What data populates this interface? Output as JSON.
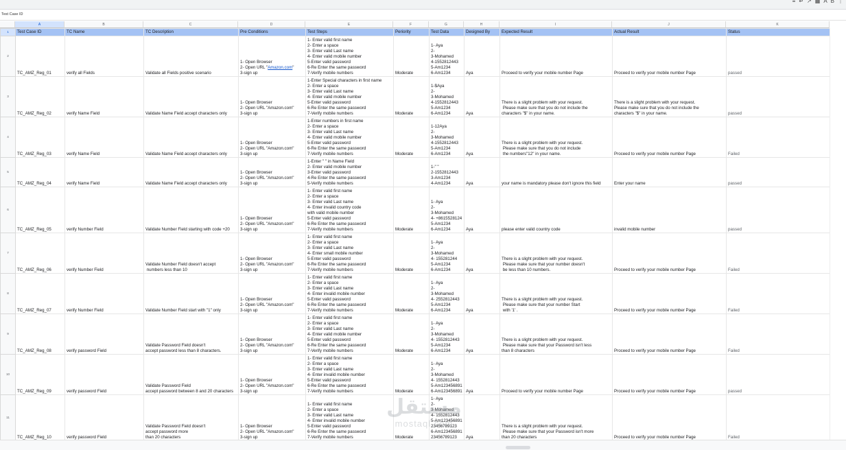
{
  "formula_bar": {
    "cell_value": "Test Case ID"
  },
  "columns": [
    "A",
    "B",
    "C",
    "D",
    "E",
    "F",
    "G",
    "H",
    "I",
    "J",
    "K"
  ],
  "selected_column": "A",
  "header_row": {
    "row_number": "1",
    "cells": [
      "Test Case ID",
      "TC Name",
      "TC Description",
      "Pre Conditions",
      "Test Steps",
      "Periority",
      "Test Data",
      "Designed By",
      "Expected Result",
      "Actual Result",
      "Status"
    ]
  },
  "rows": [
    {
      "row_number": "2",
      "cells": [
        "TC_AMZ_Reg_01",
        "verify all Fields",
        "Validate all Fields positive scenario",
        "1- Open Browser\n2- Open URL \"Amazon.com\"\n3-sign up",
        "1- Enter valid first name\n2- Enter a space\n3- Enter valid Last name\n4- Enter valid mobile number\n5-Enter valid password\n6-Re Enter the same password\n7-Verify mobile numbers",
        "Moderate",
        "1- Aya\n2-\n3-Mohamed\n4-1552812443\n5-Am1234\n6-Am1234",
        "Aya",
        "Proceed to verify your mobile number Page",
        "Proceed to verify your mobile number Page",
        "passed"
      ]
    },
    {
      "row_number": "3",
      "cells": [
        "TC_AMZ_Reg_02",
        "verify Name Field",
        "Validate Name Field accept characters only",
        "1- Open Browser\n2- Open URL \"Amazon.com\"\n3-sign up",
        "1-Enter Special characters in first name\n2- Enter a space\n3- Enter valid Last name\n4- Enter valid mobile number\n5-Enter valid password\n6-Re Enter the same password\n7-Verify mobile numbers",
        "Moderate",
        "1-$Aya\n2-\n3-Mohamed\n4-1552812443\n5-Am1234\n6-Am1234",
        "Aya",
        "There is a slight problem with your request.\n Please make sure that you do not include the\ncharacters \"$\" in your name.",
        "There is a slight problem with your request.\nPlease make sure that you do not include the\ncharacters \"$\" in your name.",
        "passed"
      ]
    },
    {
      "row_number": "4",
      "cells": [
        "TC_AMZ_Reg_03",
        "verify Name Field",
        "Validate Name Field accept characters only",
        "1- Open Browser\n2- Open URL \"Amazon.com\"\n3-sign up",
        "1-Enter numbers in first name\n2- Enter a space\n3- Enter valid Last name\n4- Enter valid mobile number\n5-Enter valid password\n6-Re Enter the same password\n7-Verify mobile numbers",
        "Moderate",
        "1-12Aya\n2-\n3-Mohamed\n4-1552812443\n5-Am1234\n6-Am1234",
        "Aya",
        "There is a slight problem with your request.\n Please make sure that you do not include\n the numbers\"12\" in your name.",
        "Proceed to verify your mobile number Page",
        "Failed"
      ]
    },
    {
      "row_number": "5",
      "cells": [
        "TC_AMZ_Reg_04",
        "verify Name Field",
        "Validate Name Field accept characters only",
        "1- Open Browser\n2- Open URL \"Amazon.com\"\n3-sign up",
        "1-Enter \" \" in Name Field\n2- Enter valid mobile number\n3-Enter valid password\n4-Re Enter the same password\n5-Verify mobile numbers",
        "",
        "1-\" \"\n2-1552812443\n3-Am1234\n4-Am1234",
        "Aya",
        "your name is mandatory please don't ignore this field",
        "Enter your name",
        "passed"
      ]
    },
    {
      "row_number": "6",
      "cells": [
        "TC_AMZ_Reg_05",
        "verify Number Field",
        "Validate Number Field starting with code +20",
        "1- Open Browser\n2- Open URL \"Amazon.com\"\n3-sign up",
        "1- Enter valid first name\n2- Enter a space\n3- Enter valid Last name\n4- Enter invalid country code\nwith valid mobile number\n5-Enter valid password\n6-Re Enter the same password\n7-Verify mobile numbers",
        "Moderate",
        "1- Aya\n2-\n3-Mohamed\n4- +8615528124\n5-Am1234\n6-Am1234",
        "Aya",
        "please enter valid country code",
        "invalid mobile number",
        "passed"
      ]
    },
    {
      "row_number": "7",
      "cells": [
        "TC_AMZ_Reg_06",
        "verify Number Field",
        "Validate Number Field doesn't accept\n numbers less than 10",
        "1- Open Browser\n2- Open URL \"Amazon.com\"\n3-sign up",
        "1- Enter valid first name\n2- Enter a space\n3- Enter valid Last name\n4- Enter small mobile number\n5-Enter valid password\n6-Re Enter the same password\n7-Verify mobile numbers",
        "Moderate",
        "1- Aya\n2-\n3-Mohamed\n4- 155281244\n5-Am1234\n6-Am1234",
        "Aya",
        "There is a slight problem with your request.\n Please make sure that your number doesn't\n be less than 10 numbers.",
        "Proceed to verify your mobile number Page",
        "Failed"
      ]
    },
    {
      "row_number": "8",
      "cells": [
        "TC_AMZ_Reg_07",
        "verify Number Field",
        "Validate Number Field start with \"1\" only",
        "1- Open Browser\n2- Open URL \"Amazon.com\"\n3-sign up",
        "1- Enter valid first name\n2- Enter a space\n3- Enter valid Last name\n4- Enter invalid mobile number\n5-Enter valid password\n6-Re Enter the same password\n7-Verify mobile numbers",
        "Moderate",
        "1- Aya\n2-\n3-Mohamed\n4- 2552812443\n5-Am1234\n6-Am1234",
        "Aya",
        "There is a slight problem with your request.\n Please make sure that your number Start\n with '1' .",
        "Proceed to verify your mobile number Page",
        "Failed"
      ]
    },
    {
      "row_number": "9",
      "cells": [
        "TC_AMZ_Reg_08",
        "verify password Field",
        "Validate Password Field doesn't\naccept password less than 8 characters.",
        "1- Open Browser\n2- Open URL \"Amazon.com\"\n3-sign up",
        "1- Enter valid first name\n2- Enter a space\n3- Enter valid Last name\n4- Enter valid mobile number\n5-Enter valid password\n6-Re Enter the same password\n7-Verify mobile numbers",
        "Moderate",
        "1- Aya\n2-\n3-Mohamed\n4- 1552812443\n5-Am1234\n6-Am1234",
        "Aya",
        "There is a slight problem with your request.\n Please make sure that your Password isn't less\nthan 8 characters",
        "Proceed to verify your mobile number Page",
        "Failed"
      ]
    },
    {
      "row_number": "10",
      "cells": [
        "TC_AMZ_Reg_09",
        "verify password Field",
        "Validate Password Field\naccept password between 8 and 20 characters",
        "1- Open Browser\n2- Open URL \"Amazon.com\"\n3-sign up",
        "1- Enter valid first name\n2- Enter a space\n3- Enter valid Last name\n4- Enter invalid mobile number\n5-Enter valid password\n6-Re Enter the same password\n7-Verify mobile numbers",
        "Moderate",
        "1- Aya\n2-\n3-Mohamed\n4- 1552812443\n5-Am123456891\n6-Am123456891",
        "Aya",
        "Proceed to verify your mobile number Page",
        "Proceed to verify your mobile number Page",
        "passed"
      ]
    },
    {
      "row_number": "11",
      "cells": [
        "TC_AMZ_Reg_10",
        "verify password Field",
        "Validate Password Field doesn't\naccept password more\nthan 20 characters",
        "1- Open Browser\n2- Open URL \"Amazon.com\"\n3-sign up",
        "1- Enter valid first name\n2- Enter a space\n3- Enter valid Last name\n4- Enter invalid mobile number\n5-Enter valid password\n6-Re Enter the same password\n7-Verify mobile numbers",
        "Moderate",
        "1- Aya\n2-\n3-Mohamed\n4- 1552812443\n5-Am123456891\n23456789123\n6-Am123456891\n23456789123",
        "Aya",
        "There is a slight problem with your request.\n Please make sure that your Password isn't more\nthan 20 characters",
        "Proceed to verify your mobile number Page",
        "Failed"
      ]
    }
  ],
  "watermark": {
    "arabic": "مستقل",
    "latin": "mostaql.com"
  },
  "colors": {
    "header_fill": "#a4c2f4",
    "selected_header": "#d3e3fd"
  }
}
